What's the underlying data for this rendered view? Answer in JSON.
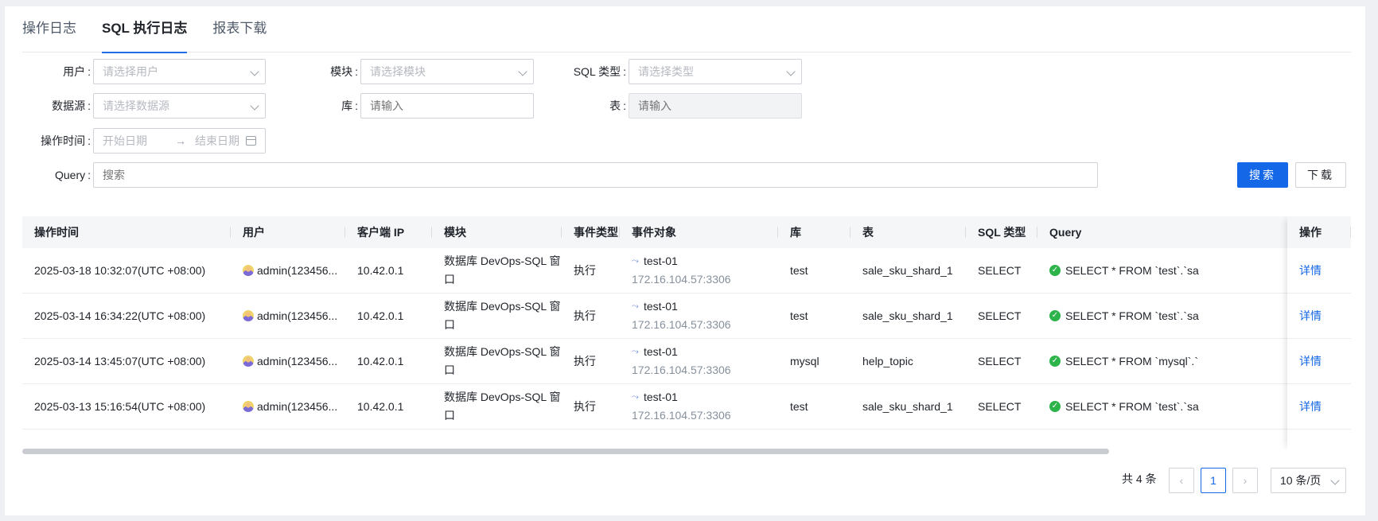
{
  "tabs": [
    "操作日志",
    "SQL 执行日志",
    "报表下载"
  ],
  "filters": {
    "user": {
      "label": "用户",
      "placeholder": "请选择用户"
    },
    "module": {
      "label": "模块",
      "placeholder": "请选择模块"
    },
    "sql_type": {
      "label": "SQL 类型",
      "placeholder": "请选择类型"
    },
    "datasource": {
      "label": "数据源",
      "placeholder": "请选择数据源"
    },
    "database": {
      "label": "库",
      "placeholder": "请输入"
    },
    "table": {
      "label": "表",
      "placeholder": "请输入"
    },
    "time": {
      "label": "操作时间",
      "start_placeholder": "开始日期",
      "end_placeholder": "结束日期"
    },
    "query": {
      "label": "Query",
      "placeholder": "搜索"
    }
  },
  "buttons": {
    "search": "搜索",
    "download": "下载"
  },
  "table": {
    "columns": [
      "操作时间",
      "用户",
      "客户端 IP",
      "模块",
      "事件类型",
      "事件对象",
      "库",
      "表",
      "SQL 类型",
      "Query",
      "操作"
    ],
    "rows": [
      {
        "time": "2025-03-18 10:32:07(UTC +08:00)",
        "user": "admin(123456...",
        "ip": "10.42.0.1",
        "module": "数据库 DevOps-SQL 窗口",
        "event_type": "执行",
        "object_name": "test-01",
        "object_addr": "172.16.104.57:3306",
        "db": "test",
        "table": "sale_sku_shard_1",
        "sql_type": "SELECT",
        "query": "SELECT * FROM `test`.`sa",
        "action": "详情"
      },
      {
        "time": "2025-03-14 16:34:22(UTC +08:00)",
        "user": "admin(123456...",
        "ip": "10.42.0.1",
        "module": "数据库 DevOps-SQL 窗口",
        "event_type": "执行",
        "object_name": "test-01",
        "object_addr": "172.16.104.57:3306",
        "db": "test",
        "table": "sale_sku_shard_1",
        "sql_type": "SELECT",
        "query": "SELECT * FROM `test`.`sa",
        "action": "详情"
      },
      {
        "time": "2025-03-14 13:45:07(UTC +08:00)",
        "user": "admin(123456...",
        "ip": "10.42.0.1",
        "module": "数据库 DevOps-SQL 窗口",
        "event_type": "执行",
        "object_name": "test-01",
        "object_addr": "172.16.104.57:3306",
        "db": "mysql",
        "table": "help_topic",
        "sql_type": "SELECT",
        "query": "SELECT * FROM `mysql`.`",
        "action": "详情"
      },
      {
        "time": "2025-03-13 15:16:54(UTC +08:00)",
        "user": "admin(123456...",
        "ip": "10.42.0.1",
        "module": "数据库 DevOps-SQL 窗口",
        "event_type": "执行",
        "object_name": "test-01",
        "object_addr": "172.16.104.57:3306",
        "db": "test",
        "table": "sale_sku_shard_1",
        "sql_type": "SELECT",
        "query": "SELECT * FROM `test`.`sa",
        "action": "详情"
      }
    ]
  },
  "pagination": {
    "total": "共 4 条",
    "current": "1",
    "page_size": "10 条/页"
  },
  "colors": {
    "primary": "#1467e6",
    "success": "#2cb34a"
  },
  "icons": {
    "select": "chevron-down-icon",
    "calendar": "calendar-icon",
    "object": "database-icon",
    "status": "check-circle-icon"
  }
}
